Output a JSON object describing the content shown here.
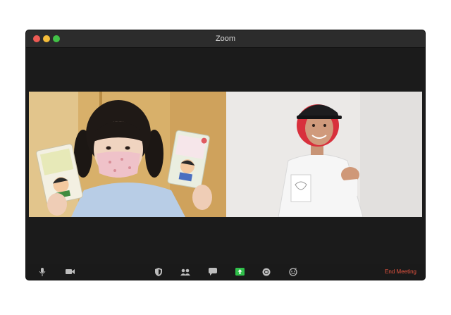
{
  "window": {
    "title": "Zoom"
  },
  "participants": [
    {
      "name": "participant-left",
      "background": "#d9b46a"
    },
    {
      "name": "participant-right",
      "background": "#e8e6e4"
    }
  ],
  "toolbar": {
    "icons": [
      "microphone-icon",
      "video-camera-icon",
      "security-shield-icon",
      "participants-icon",
      "chat-icon",
      "share-screen-icon",
      "record-icon",
      "reactions-icon"
    ],
    "end_label": "End Meeting",
    "end_color": "#e5533f",
    "share_color": "#2fbf4a"
  }
}
